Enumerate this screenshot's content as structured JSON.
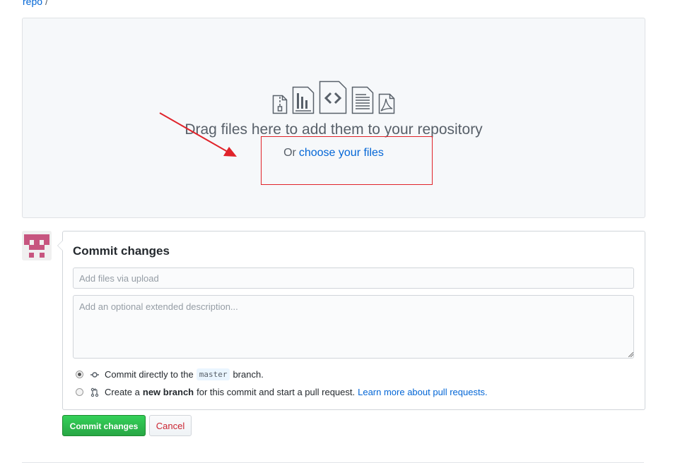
{
  "breadcrumb": {
    "repo": "repo",
    "separator": "/"
  },
  "dropzone": {
    "title": "Drag files here to add them to your repository",
    "or_text": "Or",
    "choose_link": "choose your files",
    "icons": [
      "zip-file-icon",
      "chart-file-icon",
      "code-file-icon",
      "text-file-icon",
      "pdf-file-icon"
    ]
  },
  "commit": {
    "title": "Commit changes",
    "summary_placeholder": "Add files via upload",
    "description_placeholder": "Add an optional extended description...",
    "option_direct": {
      "prefix": "Commit directly to the",
      "branch": "master",
      "suffix": "branch.",
      "checked": true
    },
    "option_new_branch": {
      "prefix": "Create a",
      "bold": "new branch",
      "suffix": "for this commit and start a pull request.",
      "link": "Learn more about pull requests.",
      "checked": false
    }
  },
  "buttons": {
    "commit": "Commit changes",
    "cancel": "Cancel"
  },
  "colors": {
    "link": "#0366d6",
    "annotation": "#e0232a",
    "commit_button": "#28a745",
    "cancel_text": "#cb2431",
    "avatar": "#c7557f"
  }
}
